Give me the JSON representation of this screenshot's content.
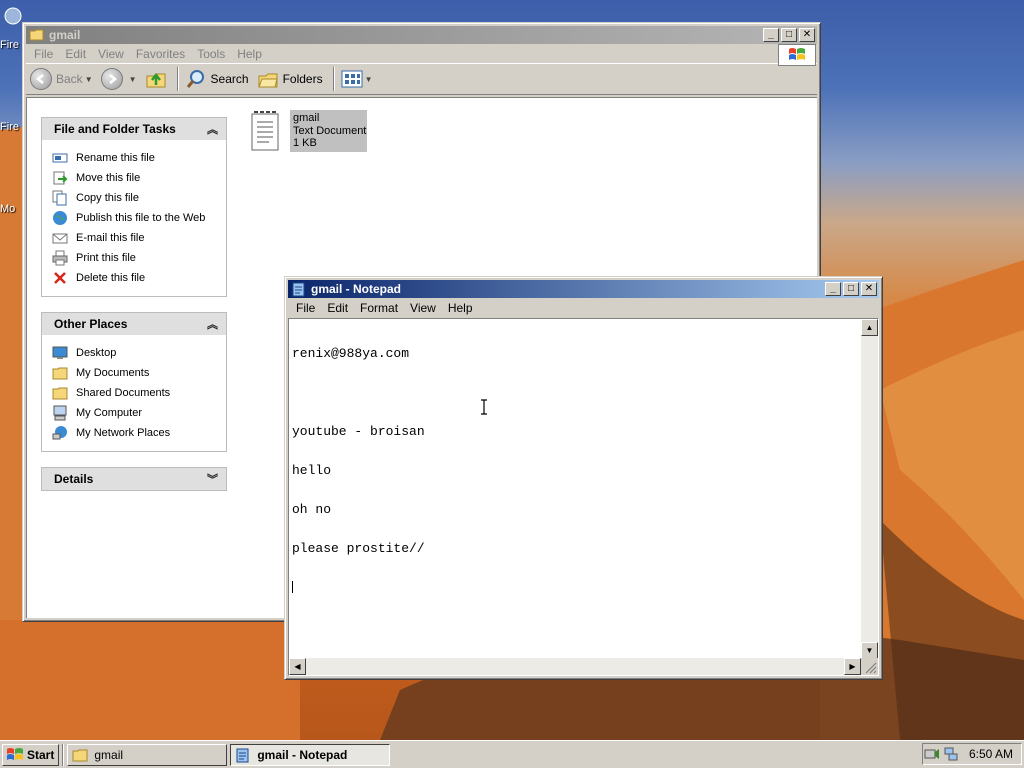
{
  "desktop": {
    "icon_labels": [
      "Fire",
      "Fire",
      "Mo"
    ]
  },
  "explorer": {
    "title": "gmail",
    "menu": [
      "File",
      "Edit",
      "View",
      "Favorites",
      "Tools",
      "Help"
    ],
    "toolbar": {
      "back_label": "Back",
      "search_label": "Search",
      "folders_label": "Folders"
    },
    "tasks_panel": {
      "title": "File and Folder Tasks",
      "items": [
        {
          "label": "Rename this file",
          "icon": "rename-icon"
        },
        {
          "label": "Move this file",
          "icon": "move-icon"
        },
        {
          "label": "Copy this file",
          "icon": "copy-icon"
        },
        {
          "label": "Publish this file to the Web",
          "icon": "globe-icon"
        },
        {
          "label": "E-mail this file",
          "icon": "email-icon"
        },
        {
          "label": "Print this file",
          "icon": "printer-icon"
        },
        {
          "label": "Delete this file",
          "icon": "delete-icon"
        }
      ]
    },
    "places_panel": {
      "title": "Other Places",
      "items": [
        {
          "label": "Desktop",
          "icon": "desktop-icon"
        },
        {
          "label": "My Documents",
          "icon": "folder-icon"
        },
        {
          "label": "Shared Documents",
          "icon": "folder-icon"
        },
        {
          "label": "My Computer",
          "icon": "computer-icon"
        },
        {
          "label": "My Network Places",
          "icon": "network-icon"
        }
      ]
    },
    "details_panel": {
      "title": "Details"
    },
    "file": {
      "name": "gmail",
      "type": "Text Document",
      "size": "1 KB"
    }
  },
  "notepad": {
    "title": "gmail - Notepad",
    "menu": [
      "File",
      "Edit",
      "Format",
      "View",
      "Help"
    ],
    "lines": [
      "renix@988ya.com",
      "",
      "youtube - broisan",
      "hello",
      "oh no",
      "please prostite//"
    ]
  },
  "taskbar": {
    "start_label": "Start",
    "tasks": [
      {
        "label": "gmail",
        "active": false
      },
      {
        "label": "gmail - Notepad",
        "active": true
      }
    ],
    "clock": "6:50 AM"
  },
  "colors": {
    "active_title_start": "#0a246a",
    "active_title_end": "#a6caf0",
    "inactive_title": "#808080",
    "face": "#d4d0c8"
  }
}
